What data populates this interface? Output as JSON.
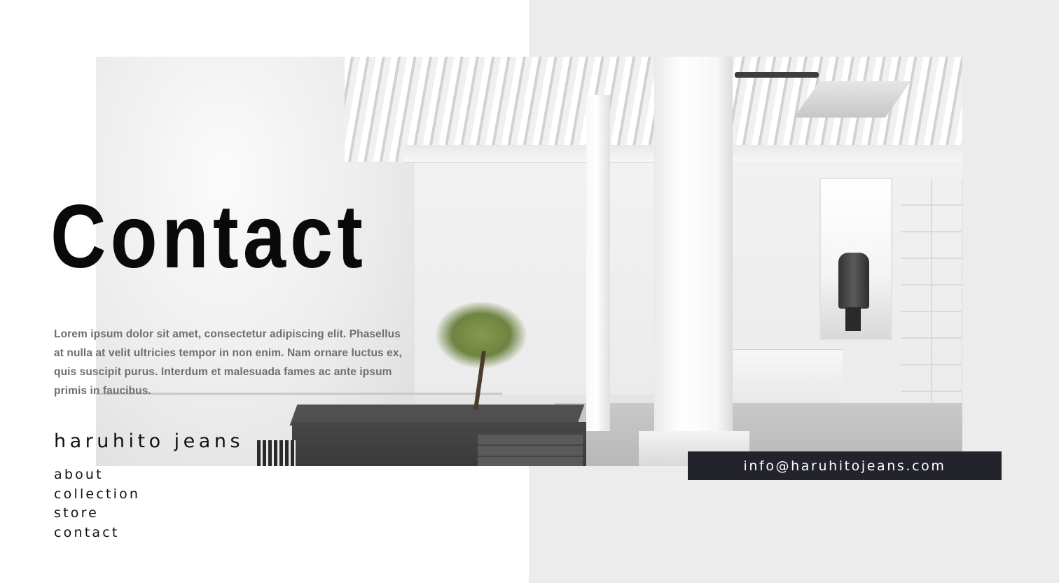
{
  "page": {
    "title": "Contact",
    "description": "Lorem ipsum dolor sit amet, consectetur adipiscing elit. Phasellus at nulla at velit ultricies tempor in non enim. Nam ornare luctus ex, quis suscipit purus. Interdum et malesuada fames ac ante ipsum primis in faucibus."
  },
  "brand": {
    "name": "haruhito jeans"
  },
  "nav": {
    "items": [
      {
        "label": "about"
      },
      {
        "label": "collection"
      },
      {
        "label": "store"
      },
      {
        "label": "contact"
      }
    ]
  },
  "contact": {
    "email": "info@haruhitojeans.com"
  },
  "colors": {
    "background": "#ffffff",
    "panel": "#ececec",
    "email_bar": "#22232b",
    "title_text": "#0a0a0a",
    "body_text": "#6f6f6f"
  },
  "hero_image": {
    "subject": "store-interior-photo"
  }
}
